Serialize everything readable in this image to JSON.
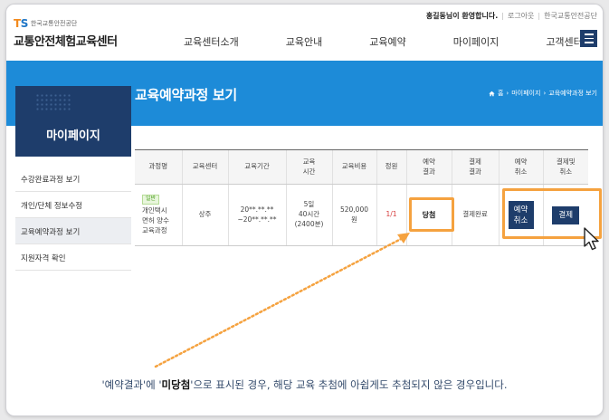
{
  "header": {
    "logo_mark_a": "T",
    "logo_mark_b": "S",
    "logo_sub": "한국교통안전공단",
    "logo_title": "교통안전체험교육센터",
    "welcome": "홍길동님이 환영합니다.",
    "logout": "로그아웃",
    "org_link": "한국교통안전공단",
    "nav": [
      "교육센터소개",
      "교육안내",
      "교육예약",
      "마이페이지",
      "고객센터"
    ]
  },
  "banner": {
    "title": "교육예약과정 보기",
    "breadcrumb": [
      "홈",
      "마이페이지",
      "교육예약과정 보기"
    ]
  },
  "sidebar": {
    "title": "마이페이지",
    "items": [
      {
        "label": "수강완료과정 보기"
      },
      {
        "label": "개인/단체 정보수정"
      },
      {
        "label": "교육예약과정 보기"
      },
      {
        "label": "지원자격 확인"
      }
    ]
  },
  "table": {
    "headers": [
      "과정명",
      "교육센터",
      "교육기간",
      "교육\n시간",
      "교육비용",
      "정원",
      "예약\n결과",
      "결제\n결과",
      "예약\n취소",
      "결제및\n취소"
    ],
    "row": {
      "badge": "일반",
      "course": "개인택시\n면허 양수\n교육과정",
      "center": "상주",
      "period": "20**.**.**\n~20**.**.**",
      "hours": "5일\n40시간\n(2400분)",
      "cost": "520,000\n원",
      "capacity": "1/1",
      "reservation_result": "당첨",
      "payment_result": "결제완료",
      "cancel_button": "예약\n취소",
      "pay_button": "결제"
    }
  },
  "caption": {
    "prefix": "'예약결과'에 '",
    "emphasis": "미당첨",
    "suffix": "'으로 표시된 경우, 해당 교육 추첨에 아쉽게도 추첨되지 않은 경우입니다."
  },
  "colors": {
    "banner": "#1d8bd8",
    "navy": "#1e3d6b",
    "highlight": "#f5a23f"
  }
}
